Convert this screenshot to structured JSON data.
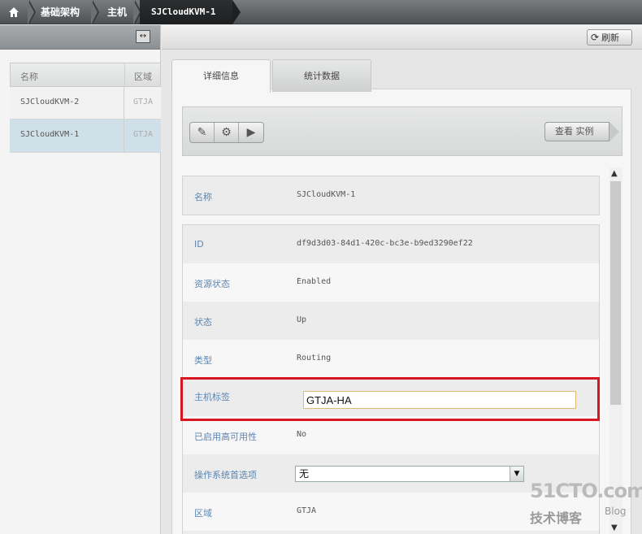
{
  "breadcrumb": {
    "home_icon": "home-icon",
    "items": [
      "基础架构",
      "主机",
      "SJCloudKVM-1"
    ]
  },
  "left_panel": {
    "columns": [
      "名称",
      "区域"
    ],
    "rows": [
      {
        "name": "SJCloudKVM-2",
        "zone": "GTJA",
        "selected": false
      },
      {
        "name": "SJCloudKVM-1",
        "zone": "GTJA",
        "selected": true
      }
    ]
  },
  "toolbar": {
    "refresh_label": "刷新"
  },
  "tabs": [
    {
      "label": "详细信息",
      "active": true
    },
    {
      "label": "统计数据",
      "active": false
    }
  ],
  "actions": {
    "icons": [
      "edit-icon",
      "gear-icon",
      "media-icon"
    ],
    "view_instances_label": "查看 实例"
  },
  "details": {
    "name_label": "名称",
    "name_value": "SJCloudKVM-1",
    "id_label": "ID",
    "id_value": "df9d3d03-84d1-420c-bc3e-b9ed3290ef22",
    "resource_state_label": "资源状态",
    "resource_state_value": "Enabled",
    "state_label": "状态",
    "state_value": "Up",
    "type_label": "类型",
    "type_value": "Routing",
    "host_tags_label": "主机标签",
    "host_tags_value": "GTJA-HA",
    "ha_enabled_label": "已启用高可用性",
    "ha_enabled_value": "No",
    "os_pref_label": "操作系统首选项",
    "os_pref_value": "无",
    "zone_label": "区域",
    "zone_value": "GTJA"
  },
  "watermark": {
    "line1": "51CTO.com",
    "line2": "技术博客",
    "line3": "Blog"
  },
  "colors": {
    "highlight": "#d9161f",
    "label_blue": "#5a86b4",
    "selected_row": "#cfe0e8"
  }
}
